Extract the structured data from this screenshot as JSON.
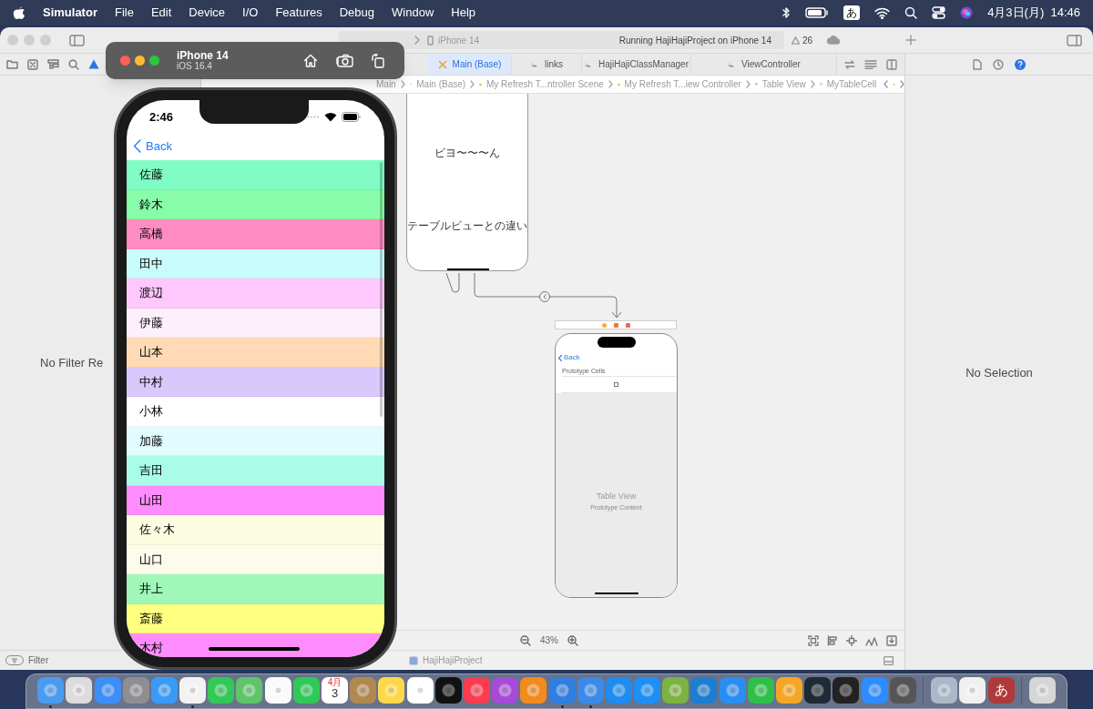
{
  "menu_bar": {
    "menus": [
      "Simulator",
      "File",
      "Edit",
      "Device",
      "I/O",
      "Features",
      "Debug",
      "Window",
      "Help"
    ],
    "input_source": "あ",
    "clock": "4月3日(月)  14:46"
  },
  "xcode": {
    "toolbar": {
      "destination": "iPhone 14",
      "status": "Running HajiHajiProject on iPhone 14",
      "warnings": "26"
    },
    "tabs": [
      {
        "label": "Main (Base)",
        "selected": true
      },
      {
        "label": "links",
        "selected": false
      },
      {
        "label": "HajiHajiClassManager",
        "selected": false
      },
      {
        "label": "ViewController",
        "selected": false
      }
    ],
    "breadcrumbs": [
      "Main",
      "Main (Base)",
      "My Refresh T...ntroller Scene",
      "My Refresh T...iew Controller",
      "Table View",
      "MyTableCell"
    ],
    "navigator": {
      "message": "No Filter Re",
      "filter_placeholder": "Filter"
    },
    "canvas": {
      "scene_1": {
        "labels": [
          "ビヨ〜〜〜ん",
          "テーブルビューとの違い"
        ]
      },
      "scene_2": {
        "back": "Back",
        "section": "Prototype Cells",
        "title": "Table View",
        "subtitle": "Prototype Content"
      },
      "zoom": "43%"
    },
    "inspector": {
      "message": "No Selection"
    },
    "status_bar": {
      "project": "HajiHajiProject"
    }
  },
  "simulator": {
    "device": "iPhone 14",
    "os": "iOS 16.4",
    "time": "2:46",
    "back": "Back",
    "rows": [
      {
        "name": "佐藤",
        "color": "#80fcc4"
      },
      {
        "name": "鈴木",
        "color": "#88fca8"
      },
      {
        "name": "高橋",
        "color": "#ff8cc0"
      },
      {
        "name": "田中",
        "color": "#c8fcfc"
      },
      {
        "name": "渡辺",
        "color": "#ffc8fc"
      },
      {
        "name": "伊藤",
        "color": "#fcf0fc"
      },
      {
        "name": "山本",
        "color": "#ffdab4"
      },
      {
        "name": "中村",
        "color": "#d8c8fc"
      },
      {
        "name": "小林",
        "color": "#ffffff"
      },
      {
        "name": "加藤",
        "color": "#e0fcfc"
      },
      {
        "name": "吉田",
        "color": "#a8fce8"
      },
      {
        "name": "山田",
        "color": "#ff8cfc"
      },
      {
        "name": "佐々木",
        "color": "#fcfce0"
      },
      {
        "name": "山口",
        "color": "#fcfcec"
      },
      {
        "name": "井上",
        "color": "#a0f8b8"
      },
      {
        "name": "斎藤",
        "color": "#ffff80"
      },
      {
        "name": "木村",
        "color": "#ff8cfc"
      }
    ]
  },
  "dock": [
    {
      "kind": "app",
      "color": "#4a9bf0",
      "running": true
    },
    {
      "kind": "app",
      "color": "#dcdcdc",
      "running": false
    },
    {
      "kind": "app",
      "color": "#3d8ff7",
      "running": false
    },
    {
      "kind": "app",
      "color": "#8e8e93",
      "running": false
    },
    {
      "kind": "app",
      "color": "#3a9af5",
      "running": false
    },
    {
      "kind": "app",
      "color": "#f2f2f2",
      "running": true
    },
    {
      "kind": "app",
      "color": "#34c759",
      "running": false
    },
    {
      "kind": "app",
      "color": "#5fc46a",
      "running": false
    },
    {
      "kind": "app",
      "color": "#fafafa",
      "running": false
    },
    {
      "kind": "app",
      "color": "#32c759",
      "running": false
    },
    {
      "kind": "calendar",
      "color": "#ffffff",
      "running": false,
      "month": "4月",
      "day": "3"
    },
    {
      "kind": "app",
      "color": "#b08850",
      "running": false
    },
    {
      "kind": "app",
      "color": "#ffd84a",
      "running": false
    },
    {
      "kind": "app",
      "color": "#ffffff",
      "running": false
    },
    {
      "kind": "app",
      "color": "#111111",
      "running": false
    },
    {
      "kind": "app",
      "color": "#fa3c50",
      "running": false
    },
    {
      "kind": "app",
      "color": "#a54bd8",
      "running": false
    },
    {
      "kind": "app",
      "color": "#f28b1e",
      "running": false
    },
    {
      "kind": "app",
      "color": "#2f7fe0",
      "running": true
    },
    {
      "kind": "app",
      "color": "#3b8ae8",
      "running": true
    },
    {
      "kind": "app",
      "color": "#1e8cf0",
      "running": false
    },
    {
      "kind": "app",
      "color": "#1d8ff5",
      "running": false
    },
    {
      "kind": "app",
      "color": "#7cb342",
      "running": false
    },
    {
      "kind": "app",
      "color": "#1d7ed0",
      "running": false
    },
    {
      "kind": "app",
      "color": "#2a8ef0",
      "running": false
    },
    {
      "kind": "app",
      "color": "#2fbf4a",
      "running": false
    },
    {
      "kind": "app",
      "color": "#f5a623",
      "running": false
    },
    {
      "kind": "app",
      "color": "#1e2b34",
      "running": false
    },
    {
      "kind": "app",
      "color": "#222222",
      "running": false
    },
    {
      "kind": "app",
      "color": "#2d8cff",
      "running": false
    },
    {
      "kind": "app",
      "color": "#555555",
      "running": false
    },
    {
      "kind": "separator"
    },
    {
      "kind": "app",
      "color": "#aab8c8",
      "running": false
    },
    {
      "kind": "app",
      "color": "#f0f0f0",
      "running": false
    },
    {
      "kind": "glyph",
      "color": "#b03a3a",
      "running": false,
      "glyph": "あ"
    },
    {
      "kind": "separator"
    },
    {
      "kind": "app",
      "color": "#d6d6d6",
      "running": false
    }
  ]
}
